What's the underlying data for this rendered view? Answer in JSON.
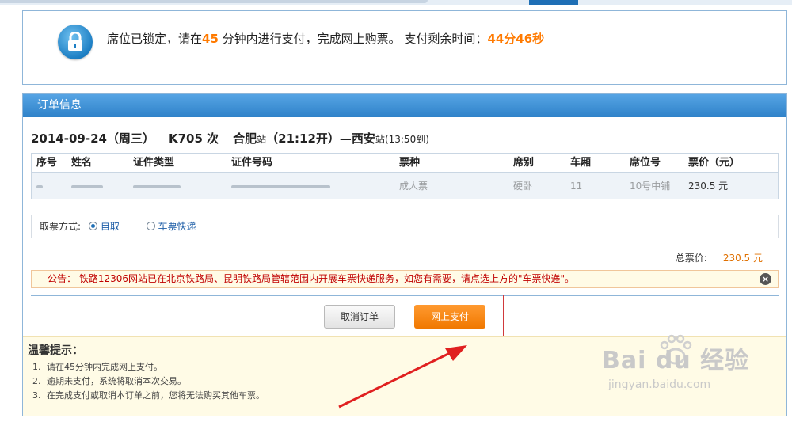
{
  "lock": {
    "msg_prefix": "席位已锁定，请在",
    "minutes": "45",
    "msg_middle": " 分钟内进行支付，完成网上购票。 支付剩余时间：",
    "remaining": "44分46秒"
  },
  "order": {
    "header": "订单信息",
    "date": "2014-09-24（周三）",
    "train": "K705 次",
    "from": "合肥",
    "station_word": "站",
    "depart": "（21:12开）—",
    "to": "西安",
    "arrive": "(13:50到)",
    "columns": [
      "序号",
      "姓名",
      "证件类型",
      "证件号码",
      "票种",
      "席别",
      "车厢",
      "席位号",
      "票价（元）"
    ],
    "row": {
      "ticket_type": "成人票",
      "seat_class": "硬卧",
      "car": "11",
      "seat_no": "10号中铺",
      "price": "230.5 元"
    },
    "pickup_label": "取票方式:",
    "pickup_options": [
      "自取",
      "车票快递"
    ],
    "total_label": "总票价:",
    "total_value": "230.5 元",
    "notice": "公告： 铁路12306网站已在北京铁路局、昆明铁路局管辖范围内开展车票快递服务，如您有需要，请点选上方的\"车票快递\"。",
    "cancel_label": "取消订单",
    "pay_label": "网上支付"
  },
  "tips": {
    "title": "温馨提示：",
    "items": [
      {
        "num": "1.",
        "text": "请在45分钟内完成网上支付。"
      },
      {
        "num": "2.",
        "text": "逾期未支付，系统将取消本次交易。"
      },
      {
        "num": "3.",
        "text": "在完成支付或取消本订单之前，您将无法购买其他车票。"
      }
    ]
  },
  "watermark": {
    "logo": "Bai du 经验",
    "url": "jingyan.baidu.com"
  },
  "colors": {
    "accent_orange": "#ff7a00",
    "header_blue": "#2f82c9",
    "notice_red": "#c00000",
    "highlight_red": "#d0393b"
  },
  "icons": [
    "lock-icon",
    "close-icon",
    "paw-icon",
    "arrow-annotation"
  ]
}
